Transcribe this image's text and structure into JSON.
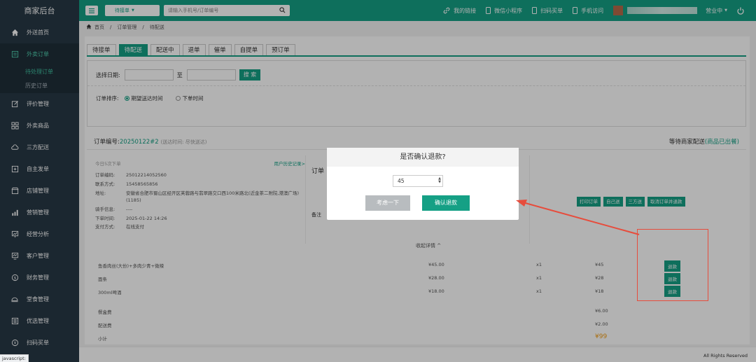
{
  "sidebar": {
    "title": "商家后台",
    "items": [
      {
        "label": "外送首页",
        "icon": "home-icon"
      },
      {
        "label": "外卖订单",
        "icon": "order-icon",
        "active": true
      },
      {
        "label": "评价管理",
        "icon": "edit-icon"
      },
      {
        "label": "外卖商品",
        "icon": "grid-icon"
      },
      {
        "label": "三方配送",
        "icon": "cloud-icon"
      },
      {
        "label": "自主发单",
        "icon": "send-icon"
      },
      {
        "label": "店铺管理",
        "icon": "store-icon"
      },
      {
        "label": "营销管理",
        "icon": "chart-icon"
      },
      {
        "label": "经营分析",
        "icon": "analysis-icon"
      },
      {
        "label": "客户管理",
        "icon": "customer-icon"
      },
      {
        "label": "财务管理",
        "icon": "finance-icon"
      },
      {
        "label": "堂食管理",
        "icon": "dine-icon"
      },
      {
        "label": "优选管理",
        "icon": "select-icon"
      },
      {
        "label": "扫码买单",
        "icon": "scan-icon"
      }
    ],
    "subitems": [
      "待处理订单",
      "历史订单"
    ]
  },
  "topbar": {
    "select": "待接单",
    "search_placeholder": "请输入手机号/订单编号",
    "links": [
      "我的链接",
      "微信小程序",
      "扫码买单",
      "手机访问"
    ],
    "status": "营业中"
  },
  "breadcrumb": [
    "首页",
    "订单管理",
    "待配送"
  ],
  "tabs": [
    "待接单",
    "待配送",
    "配送中",
    "退单",
    "催单",
    "自提单",
    "预订单"
  ],
  "filter": {
    "date_label": "选择日期:",
    "to": "至",
    "search_btn": "搜 索",
    "sort_label": "订单排序:",
    "sort_opts": [
      "期望送达时间",
      "下单时间"
    ]
  },
  "order": {
    "no_label": "订单编号:",
    "no": "20250122#2",
    "hint": "(送达时间: 尽快送达)",
    "wait": "等待商家配送",
    "wait_status": "(商品已出餐)",
    "sub": "今日5次下单",
    "history": "用户历史记录>",
    "fields": [
      {
        "k": "订单编码:",
        "v": "25012214052560"
      },
      {
        "k": "联系方式:",
        "v": "15458565856"
      },
      {
        "k": "地址:",
        "v": "安徽省合肥市蜀山区经开区芙蓉路与翡翠路交口西100米路北(近金茶二附院,港澳广场)(1185)"
      },
      {
        "k": "骑手信息:",
        "v": "----"
      },
      {
        "k": "下单时间:",
        "v": "2025-01-22 14:26"
      },
      {
        "k": "支付方式:",
        "v": "在线支付"
      }
    ],
    "mid_title": "订单",
    "mid_note": "备注",
    "actions": [
      "打印订单",
      "自己送",
      "三方送",
      "取消订单并退款"
    ],
    "collapse": "收起详情 ^"
  },
  "items": [
    {
      "name": "鱼香肉丝(大份)+多肉少青+微辣",
      "price": "¥45.00",
      "qty": "x1",
      "total": "¥45",
      "btn": "退款"
    },
    {
      "name": "面条",
      "price": "¥28.00",
      "qty": "x1",
      "total": "¥28",
      "btn": "退款"
    },
    {
      "name": "300ml啤酒",
      "price": "¥18.00",
      "qty": "x1",
      "total": "¥18",
      "btn": "退款"
    }
  ],
  "fees": [
    {
      "k": "餐盒费",
      "v": "¥6.00"
    },
    {
      "k": "配送费",
      "v": "¥2.00"
    },
    {
      "k": "小计",
      "v": "¥99"
    }
  ],
  "modal": {
    "title": "是否确认退款?",
    "value": "45",
    "cancel": "考虑一下",
    "confirm": "确认退款"
  },
  "footer": "All Rights Reserved",
  "statusbar": "javascript:",
  "colors": {
    "accent": "#15a085",
    "sidebar": "#283845",
    "highlight": "#e74c3c"
  }
}
